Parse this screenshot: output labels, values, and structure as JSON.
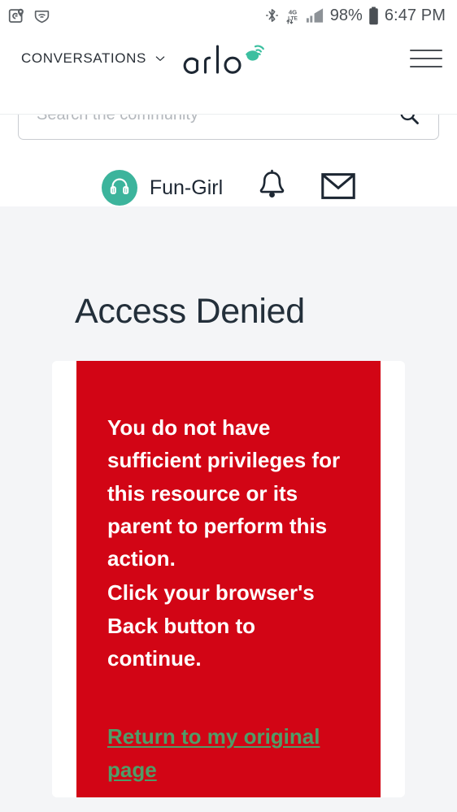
{
  "statusbar": {
    "left_icons": [
      "google-maps-icon",
      "vpn-shield-icon"
    ],
    "right_icons": [
      "bluetooth-icon",
      "mobile-data-4g-lte-icon",
      "signal-bars-icon",
      "battery-icon"
    ],
    "battery_percent": "98%",
    "time": "6:47 PM"
  },
  "header": {
    "nav_label": "CONVERSATIONS",
    "nav_chevron": "chevron-down-icon",
    "logo_text": "arlo",
    "logo_mark": "arlo-camera-signal-icon",
    "menu_icon": "hamburger-menu-icon",
    "search": {
      "placeholder": "Search the community",
      "value": "",
      "icon": "search-icon"
    },
    "user": {
      "avatar_icon": "headphones-avatar-icon",
      "name": "Fun-Girl",
      "notifications_icon": "bell-icon",
      "messages_icon": "envelope-icon"
    }
  },
  "main": {
    "title": "Access Denied",
    "alert": {
      "message_line_1": "You do not have sufficient privileges for this resource or its parent to perform this action.",
      "message_line_2_prefix": "Click your browser's ",
      "message_line_2_bold": "Back",
      "message_line_2_suffix": " button to continue.",
      "link_label": "Return to my original page"
    }
  },
  "colors": {
    "alert_red": "#D20515",
    "link_green": "#4F9D68",
    "avatar_teal": "#3CB49C",
    "logo_accent_green": "#3CBFA0",
    "page_background": "#F4F5F7",
    "title_navy": "#232F3A"
  }
}
